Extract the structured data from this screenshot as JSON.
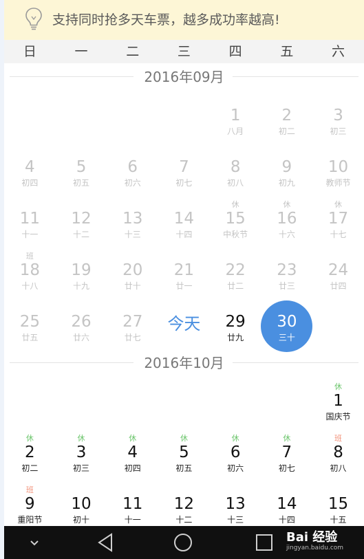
{
  "tip": {
    "text": "支持同时抢多天车票，越多成功率越高!"
  },
  "weekdays": [
    "日",
    "一",
    "二",
    "三",
    "四",
    "五",
    "六"
  ],
  "months": [
    {
      "title": "2016年09月",
      "days": [
        {
          "n": "1",
          "l": "八月",
          "col": 4,
          "row": 0,
          "st": "past"
        },
        {
          "n": "2",
          "l": "初二",
          "col": 5,
          "row": 0,
          "st": "past"
        },
        {
          "n": "3",
          "l": "初三",
          "col": 6,
          "row": 0,
          "st": "past"
        },
        {
          "n": "4",
          "l": "初四",
          "col": 0,
          "row": 1,
          "st": "past"
        },
        {
          "n": "5",
          "l": "初五",
          "col": 1,
          "row": 1,
          "st": "past"
        },
        {
          "n": "6",
          "l": "初六",
          "col": 2,
          "row": 1,
          "st": "past"
        },
        {
          "n": "7",
          "l": "初七",
          "col": 3,
          "row": 1,
          "st": "past"
        },
        {
          "n": "8",
          "l": "初八",
          "col": 4,
          "row": 1,
          "st": "past"
        },
        {
          "n": "9",
          "l": "初九",
          "col": 5,
          "row": 1,
          "st": "past"
        },
        {
          "n": "10",
          "l": "教师节",
          "col": 6,
          "row": 1,
          "st": "past"
        },
        {
          "n": "11",
          "l": "十一",
          "col": 0,
          "row": 2,
          "st": "past"
        },
        {
          "n": "12",
          "l": "十二",
          "col": 1,
          "row": 2,
          "st": "past"
        },
        {
          "n": "13",
          "l": "十三",
          "col": 2,
          "row": 2,
          "st": "past"
        },
        {
          "n": "14",
          "l": "十四",
          "col": 3,
          "row": 2,
          "st": "past"
        },
        {
          "n": "15",
          "l": "中秋节",
          "col": 4,
          "row": 2,
          "st": "past",
          "h": "休",
          "ht": "rest"
        },
        {
          "n": "16",
          "l": "十六",
          "col": 5,
          "row": 2,
          "st": "past",
          "h": "休",
          "ht": "rest"
        },
        {
          "n": "17",
          "l": "十七",
          "col": 6,
          "row": 2,
          "st": "past",
          "h": "休",
          "ht": "rest"
        },
        {
          "n": "18",
          "l": "十八",
          "col": 0,
          "row": 3,
          "st": "past",
          "h": "班",
          "ht": "work"
        },
        {
          "n": "19",
          "l": "十九",
          "col": 1,
          "row": 3,
          "st": "past"
        },
        {
          "n": "20",
          "l": "廿十",
          "col": 2,
          "row": 3,
          "st": "past"
        },
        {
          "n": "21",
          "l": "廿一",
          "col": 3,
          "row": 3,
          "st": "past"
        },
        {
          "n": "22",
          "l": "廿二",
          "col": 4,
          "row": 3,
          "st": "past"
        },
        {
          "n": "23",
          "l": "廿三",
          "col": 5,
          "row": 3,
          "st": "past"
        },
        {
          "n": "24",
          "l": "廿四",
          "col": 6,
          "row": 3,
          "st": "past"
        },
        {
          "n": "25",
          "l": "廿五",
          "col": 0,
          "row": 4,
          "st": "past"
        },
        {
          "n": "26",
          "l": "廿六",
          "col": 1,
          "row": 4,
          "st": "past"
        },
        {
          "n": "27",
          "l": "廿七",
          "col": 2,
          "row": 4,
          "st": "past"
        },
        {
          "n": "今天",
          "l": "",
          "col": 3,
          "row": 4,
          "st": "today"
        },
        {
          "n": "29",
          "l": "廿九",
          "col": 4,
          "row": 4,
          "st": "active"
        },
        {
          "n": "30",
          "l": "三十",
          "col": 5,
          "row": 4,
          "st": "selected"
        }
      ]
    },
    {
      "title": "2016年10月",
      "days": [
        {
          "n": "1",
          "l": "国庆节",
          "col": 6,
          "row": 0,
          "st": "active",
          "h": "休",
          "ht": "rest"
        },
        {
          "n": "2",
          "l": "初二",
          "col": 0,
          "row": 1,
          "st": "active",
          "h": "休",
          "ht": "rest"
        },
        {
          "n": "3",
          "l": "初三",
          "col": 1,
          "row": 1,
          "st": "active",
          "h": "休",
          "ht": "rest"
        },
        {
          "n": "4",
          "l": "初四",
          "col": 2,
          "row": 1,
          "st": "active",
          "h": "休",
          "ht": "rest"
        },
        {
          "n": "5",
          "l": "初五",
          "col": 3,
          "row": 1,
          "st": "active",
          "h": "休",
          "ht": "rest"
        },
        {
          "n": "6",
          "l": "初六",
          "col": 4,
          "row": 1,
          "st": "active",
          "h": "休",
          "ht": "rest"
        },
        {
          "n": "7",
          "l": "初七",
          "col": 5,
          "row": 1,
          "st": "active",
          "h": "休",
          "ht": "rest"
        },
        {
          "n": "8",
          "l": "初八",
          "col": 6,
          "row": 1,
          "st": "active",
          "h": "班",
          "ht": "work"
        },
        {
          "n": "9",
          "l": "重阳节",
          "col": 0,
          "row": 2,
          "st": "active",
          "h": "班",
          "ht": "work"
        },
        {
          "n": "10",
          "l": "初十",
          "col": 1,
          "row": 2,
          "st": "active"
        },
        {
          "n": "11",
          "l": "十一",
          "col": 2,
          "row": 2,
          "st": "active"
        },
        {
          "n": "12",
          "l": "十二",
          "col": 3,
          "row": 2,
          "st": "active"
        },
        {
          "n": "13",
          "l": "十三",
          "col": 4,
          "row": 2,
          "st": "active"
        },
        {
          "n": "14",
          "l": "十四",
          "col": 5,
          "row": 2,
          "st": "active"
        },
        {
          "n": "15",
          "l": "十五",
          "col": 6,
          "row": 2,
          "st": "active"
        }
      ]
    }
  ],
  "navbar": {
    "icons": [
      "chevron-down-icon",
      "back-icon",
      "home-icon",
      "recents-icon"
    ]
  },
  "watermark": {
    "brand": "Bai 经验",
    "url": "jingyan.baidu.com"
  },
  "colors": {
    "accent": "#4a8fe0",
    "rest": "#6cc56c",
    "work": "#f2927a",
    "tip_bg": "#fdf6d6"
  }
}
